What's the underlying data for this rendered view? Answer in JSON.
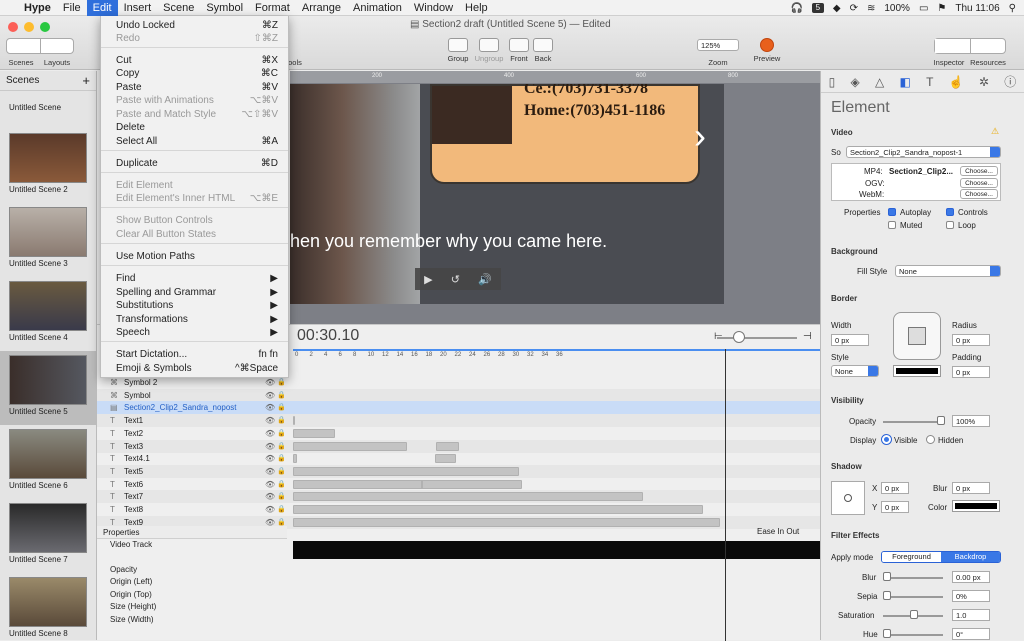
{
  "menubar": {
    "app": "Hype",
    "items": [
      "File",
      "Edit",
      "Insert",
      "Scene",
      "Symbol",
      "Format",
      "Arrange",
      "Animation",
      "Window",
      "Help"
    ],
    "battery": "100%",
    "clock": "Thu 11:06",
    "badge": "5"
  },
  "window": {
    "title": "Section2 draft (Untitled Scene 5)",
    "edited": "— Edited"
  },
  "toolbar": {
    "scenes": "Scenes",
    "layouts": "Layouts",
    "symbols_partial": "ools",
    "group": "Group",
    "ungroup": "Ungroup",
    "front": "Front",
    "back": "Back",
    "zoom_value": "125%",
    "zoom": "Zoom",
    "preview": "Preview",
    "inspector": "Inspector",
    "resources": "Resources"
  },
  "edit_menu": [
    {
      "label": "Undo Locked",
      "shortcut": "⌘Z",
      "disabled": false
    },
    {
      "label": "Redo",
      "shortcut": "⇧⌘Z",
      "disabled": true
    },
    {
      "label": "Cut",
      "shortcut": "⌘X",
      "disabled": false
    },
    {
      "label": "Copy",
      "shortcut": "⌘C",
      "disabled": false
    },
    {
      "label": "Paste",
      "shortcut": "⌘V",
      "disabled": false
    },
    {
      "label": "Paste with Animations",
      "shortcut": "⌥⌘V",
      "disabled": true
    },
    {
      "label": "Paste and Match Style",
      "shortcut": "⌥⇧⌘V",
      "disabled": true
    },
    {
      "label": "Delete",
      "shortcut": "",
      "disabled": false
    },
    {
      "label": "Select All",
      "shortcut": "⌘A",
      "disabled": false
    },
    {
      "label": "Duplicate",
      "shortcut": "⌘D",
      "disabled": false
    },
    {
      "label": "Edit Element",
      "shortcut": "",
      "disabled": true
    },
    {
      "label": "Edit Element's Inner HTML",
      "shortcut": "⌥⌘E",
      "disabled": true
    },
    {
      "label": "Show Button Controls",
      "shortcut": "",
      "disabled": true
    },
    {
      "label": "Clear All Button States",
      "shortcut": "",
      "disabled": true
    },
    {
      "label": "Use Motion Paths",
      "shortcut": "",
      "disabled": false
    },
    {
      "label": "Find",
      "shortcut": "▶",
      "disabled": false
    },
    {
      "label": "Spelling and Grammar",
      "shortcut": "▶",
      "disabled": false
    },
    {
      "label": "Substitutions",
      "shortcut": "▶",
      "disabled": false
    },
    {
      "label": "Transformations",
      "shortcut": "▶",
      "disabled": false
    },
    {
      "label": "Speech",
      "shortcut": "▶",
      "disabled": false
    },
    {
      "label": "Start Dictation...",
      "shortcut": "fn fn",
      "disabled": false
    },
    {
      "label": "Emoji & Symbols",
      "shortcut": "^⌘Space",
      "disabled": false
    }
  ],
  "scenes": {
    "header": "Scenes",
    "add": "+",
    "list": [
      "Untitled Scene",
      "Untitled Scene 2",
      "Untitled Scene 3",
      "Untitled Scene 4",
      "Untitled Scene 5",
      "Untitled Scene 6",
      "Untitled Scene 7",
      "Untitled Scene 8"
    ]
  },
  "stage": {
    "ruler": [
      "200",
      "400",
      "600",
      "800"
    ],
    "phone_top": "Ce.:(703)731-3378",
    "phone_home": "Home:(703)451-1186",
    "caption": "hen you remember why you came here."
  },
  "timeline": {
    "time": "00:30.10",
    "ticks": [
      "0",
      "2",
      "4",
      "6",
      "8",
      "10",
      "12",
      "14",
      "16",
      "18",
      "20",
      "22",
      "24",
      "26",
      "28",
      "30",
      "32",
      "34",
      "36"
    ],
    "layers": [
      "Symbol 2",
      "Symbol",
      "Section2_Clip2_Sandra_nopost",
      "Text1",
      "Text2",
      "Text3",
      "Text4.1",
      "Text5",
      "Text6",
      "Text7",
      "Text8",
      "Text9"
    ],
    "properties_header": "Properties",
    "easing": "Ease In Out",
    "props": [
      "Video Track",
      "Opacity",
      "Origin (Left)",
      "Origin (Top)",
      "Size (Height)",
      "Size (Width)"
    ]
  },
  "inspector": {
    "title": "Element",
    "video": {
      "heading": "Video",
      "source_label": "So",
      "source": "Section2_Clip2_Sandra_nopost-1",
      "mp4_label": "MP4:",
      "mp4": "Section2_Clip2...",
      "ogv_label": "OGV:",
      "webm_label": "WebM:",
      "choose": "Choose...",
      "properties": "Properties",
      "autoplay": "Autoplay",
      "controls": "Controls",
      "muted": "Muted",
      "loop": "Loop"
    },
    "background": {
      "heading": "Background",
      "fill_label": "Fill Style",
      "fill": "None"
    },
    "border": {
      "heading": "Border",
      "width_label": "Width",
      "width": "0 px",
      "radius_label": "Radius",
      "radius": "0 px",
      "style_label": "Style",
      "style": "None",
      "padding_label": "Padding",
      "padding": "0 px"
    },
    "visibility": {
      "heading": "Visibility",
      "opacity_label": "Opacity",
      "opacity": "100%",
      "display_label": "Display",
      "visible": "Visible",
      "hidden": "Hidden"
    },
    "shadow": {
      "heading": "Shadow",
      "x_label": "X",
      "x": "0 px",
      "y_label": "Y",
      "y": "0 px",
      "blur_label": "Blur",
      "blur": "0 px",
      "color_label": "Color"
    },
    "filter": {
      "heading": "Filter Effects",
      "apply_label": "Apply mode",
      "foreground": "Foreground",
      "backdrop": "Backdrop",
      "blur_label": "Blur",
      "blur": "0.00 px",
      "sepia_label": "Sepia",
      "sepia": "0%",
      "saturation_label": "Saturation",
      "saturation": "1.0",
      "hue_label": "Hue",
      "hue": "0°"
    }
  }
}
